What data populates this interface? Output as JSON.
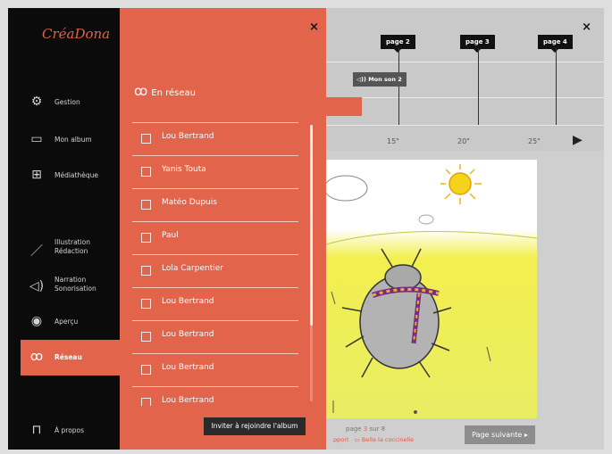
{
  "app": {
    "logo": "CréaDona"
  },
  "sidebar": {
    "items": [
      {
        "label": "Gestion",
        "icon": "gear-icon"
      },
      {
        "label": "Mon album",
        "icon": "album-icon"
      },
      {
        "label": "Médiathèque",
        "icon": "grid-icon"
      },
      {
        "label": "Illustration Rédaction",
        "icon": "brush-icon"
      },
      {
        "label": "Narration Sonorisation",
        "icon": "speaker-icon"
      },
      {
        "label": "Aperçu",
        "icon": "eye-icon"
      },
      {
        "label": "Réseau",
        "icon": "people-icon",
        "active": true
      },
      {
        "label": "À propos",
        "icon": "bookmark-icon"
      }
    ]
  },
  "panel": {
    "close": "×",
    "title": "En réseau",
    "members": [
      "Lou Bertrand",
      "Yanis Touta",
      "Matéo Dupuis",
      "Paul",
      "Lola Carpentier",
      "Lou Bertrand",
      "Lou Bertrand",
      "Lou Bertrand",
      "Lou Bertrand"
    ],
    "invite_label": "Inviter à rejoindre l'album"
  },
  "editor": {
    "close": "×",
    "page_markers": [
      "page 2",
      "page 3",
      "page 4"
    ],
    "sound_clip": "Mon son 2",
    "ticks": [
      "15\"",
      "20\"",
      "25\""
    ],
    "footer": {
      "page_prefix": "page",
      "page_current": "3",
      "page_sep": "sur",
      "page_total": "8",
      "link_left": "pport",
      "link_right": "Belle la coccinelle",
      "next_label": "Page suivante"
    }
  },
  "colors": {
    "accent": "#e2644b",
    "sidebar": "#0b0b0b"
  }
}
